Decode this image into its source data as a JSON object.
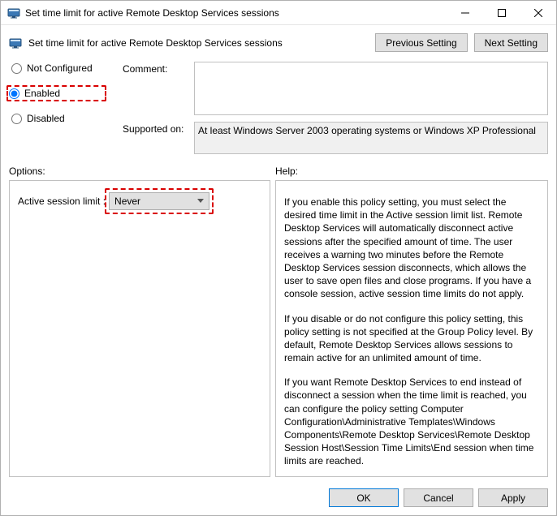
{
  "window": {
    "title": "Set time limit for active Remote Desktop Services sessions"
  },
  "header": {
    "subtitle": "Set time limit for active Remote Desktop Services sessions",
    "prev_btn": "Previous Setting",
    "next_btn": "Next Setting"
  },
  "state": {
    "not_configured": "Not Configured",
    "enabled": "Enabled",
    "disabled": "Disabled",
    "selected": "enabled"
  },
  "fields": {
    "comment_label": "Comment:",
    "comment_value": "",
    "supported_label": "Supported on:",
    "supported_value": "At least Windows Server 2003 operating systems or Windows XP Professional"
  },
  "labels": {
    "options": "Options:",
    "help": "Help:"
  },
  "options": {
    "active_session_limit_label": "Active session limit :",
    "active_session_limit_value": "Never"
  },
  "help": {
    "p1": "If you enable this policy setting, you must select the desired time limit in the Active session limit list. Remote Desktop Services will automatically disconnect active sessions after the specified amount of time. The user receives a warning two minutes before the Remote Desktop Services session disconnects, which allows the user to save open files and close programs. If you have a console session, active session time limits do not apply.",
    "p2": "If you disable or do not configure this policy setting, this policy setting is not specified at the Group Policy level. By default, Remote Desktop Services allows sessions to remain active for an unlimited amount of time.",
    "p3": "If you want Remote Desktop Services to end instead of disconnect a session when the time limit is reached, you can configure the policy setting Computer Configuration\\Administrative Templates\\Windows Components\\Remote Desktop Services\\Remote Desktop Session Host\\Session Time Limits\\End session when time limits are reached."
  },
  "footer": {
    "ok": "OK",
    "cancel": "Cancel",
    "apply": "Apply"
  }
}
